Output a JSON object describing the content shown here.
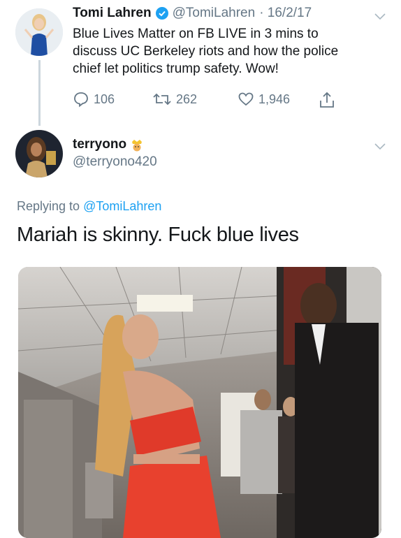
{
  "original_tweet": {
    "display_name": "Tomi Lahren",
    "handle": "@TomiLahren",
    "date": "· 16/2/17",
    "text_line1": "Blue Lives Matter on FB LIVE in 3 mins to",
    "text_line2": "discuss UC Berkeley riots and how the police",
    "text_line3": "chief let politics trump safety. Wow!",
    "replies": "106",
    "retweets": "262",
    "likes": "1,946",
    "verified": true
  },
  "reply_tweet": {
    "display_name": "terryono",
    "handle": "@terryono420",
    "replying_prefix": "Replying to",
    "replying_to": "@TomiLahren",
    "text": "Mariah is skinny. Fuck blue lives"
  },
  "colors": {
    "accent": "#1da1f2",
    "secondary_text": "#657786",
    "primary_text": "#14171a",
    "thread_line": "#ccd6dd"
  }
}
